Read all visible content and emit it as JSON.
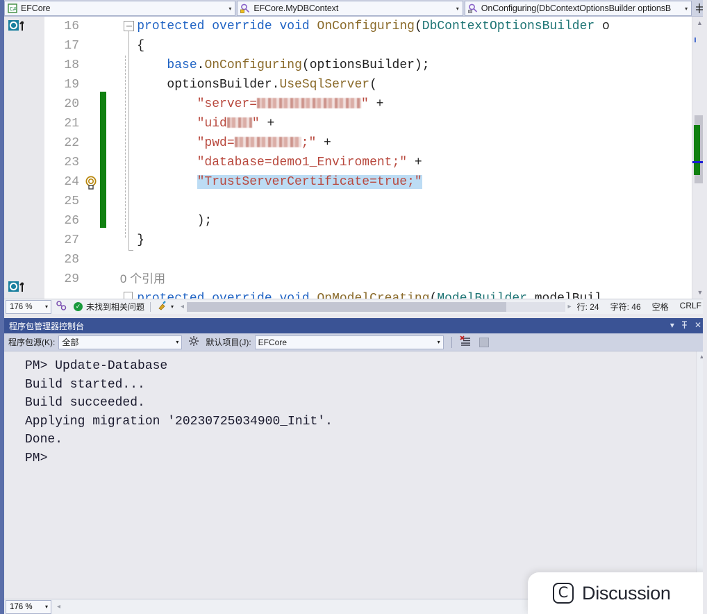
{
  "navbar": {
    "project": {
      "label": "EFCore",
      "icon": "csharp-project-icon"
    },
    "class": {
      "label": "EFCore.MyDBContext",
      "icon": "class-icon"
    },
    "member": {
      "label": "OnConfiguring(DbContextOptionsBuilder optionsB",
      "icon": "method-icon"
    },
    "split_view_icon": "split-view-icon",
    "dropdown_arrow": "▾"
  },
  "editor": {
    "gutter_icon": "inheritance-up-icon",
    "quick_actions_icon": "lightbulb-icon",
    "fold_icon": "collapse-minus-icon",
    "line_numbers": [
      "16",
      "17",
      "18",
      "19",
      "20",
      "21",
      "22",
      "23",
      "24",
      "25",
      "26",
      "27",
      "28",
      "29"
    ],
    "codelens": "0 个引用",
    "lines": [
      {
        "n": "16",
        "tokens": [
          {
            "t": "    ",
            "c": "plain"
          },
          {
            "t": "protected",
            "c": "kw"
          },
          {
            "t": " ",
            "c": "plain"
          },
          {
            "t": "override",
            "c": "kw"
          },
          {
            "t": " ",
            "c": "plain"
          },
          {
            "t": "void",
            "c": "kw"
          },
          {
            "t": " ",
            "c": "plain"
          },
          {
            "t": "OnConfiguring",
            "c": "meth"
          },
          {
            "t": "(",
            "c": "plain"
          },
          {
            "t": "DbContextOptionsBuilder",
            "c": "type"
          },
          {
            "t": " o",
            "c": "plain"
          }
        ]
      },
      {
        "n": "17",
        "tokens": [
          {
            "t": "    {",
            "c": "plain"
          }
        ]
      },
      {
        "n": "18",
        "tokens": [
          {
            "t": "        ",
            "c": "plain"
          },
          {
            "t": "base",
            "c": "kw"
          },
          {
            "t": ".",
            "c": "plain"
          },
          {
            "t": "OnConfiguring",
            "c": "meth"
          },
          {
            "t": "(optionsBuilder);",
            "c": "plain"
          }
        ]
      },
      {
        "n": "19",
        "tokens": [
          {
            "t": "        optionsBuilder.",
            "c": "plain"
          },
          {
            "t": "UseSqlServer",
            "c": "meth"
          },
          {
            "t": "(",
            "c": "plain"
          }
        ]
      },
      {
        "n": "20",
        "tokens": [
          {
            "t": "            ",
            "c": "plain"
          },
          {
            "t": "\"server=",
            "c": "str"
          },
          {
            "t": "REDACT:150",
            "c": "redact"
          },
          {
            "t": "\"",
            "c": "str"
          },
          {
            "t": " +",
            "c": "plain"
          }
        ]
      },
      {
        "n": "21",
        "tokens": [
          {
            "t": "            ",
            "c": "plain"
          },
          {
            "t": "\"uid",
            "c": "str"
          },
          {
            "t": "REDACT:36",
            "c": "redact"
          },
          {
            "t": "\"",
            "c": "str"
          },
          {
            "t": " +",
            "c": "plain"
          }
        ]
      },
      {
        "n": "22",
        "tokens": [
          {
            "t": "            ",
            "c": "plain"
          },
          {
            "t": "\"pwd=",
            "c": "str"
          },
          {
            "t": "REDACT:96",
            "c": "redact"
          },
          {
            "t": ";\"",
            "c": "str"
          },
          {
            "t": " +",
            "c": "plain"
          }
        ]
      },
      {
        "n": "23",
        "tokens": [
          {
            "t": "            ",
            "c": "plain"
          },
          {
            "t": "\"database=demo1_Enviroment;\"",
            "c": "str"
          },
          {
            "t": " +",
            "c": "plain"
          }
        ]
      },
      {
        "n": "24",
        "tokens": [
          {
            "t": "            ",
            "c": "plain"
          },
          {
            "t": "\"TrustServerCertificate=true;\"",
            "c": "str sel"
          }
        ]
      },
      {
        "n": "25",
        "tokens": [
          {
            "t": "",
            "c": "plain"
          }
        ]
      },
      {
        "n": "26",
        "tokens": [
          {
            "t": "            );",
            "c": "plain"
          }
        ]
      },
      {
        "n": "27",
        "tokens": [
          {
            "t": "    }",
            "c": "plain"
          }
        ]
      },
      {
        "n": "28",
        "tokens": [
          {
            "t": "",
            "c": "plain"
          }
        ]
      },
      {
        "n": "29",
        "tokens": [
          {
            "t": "    ",
            "c": "plain"
          },
          {
            "t": "protected override void ",
            "c": "kw"
          },
          {
            "t": "OnModelCreating",
            "c": "meth"
          },
          {
            "t": "(",
            "c": "plain"
          },
          {
            "t": "ModelBuilder",
            "c": "type"
          },
          {
            "t": " modelBuil",
            "c": "plain"
          }
        ]
      }
    ]
  },
  "editor_status": {
    "zoom": "176 %",
    "zoom_arrow": "▾",
    "issues_icon": "check-circle-icon",
    "issues": "未找到相关问题",
    "broom_icon": "code-cleanup-icon",
    "broom_arrow": "▾",
    "line_label": "行: 24",
    "char_label": "字符: 46",
    "indent": "空格",
    "eol": "CRLF",
    "scroll_left_arrow": "◂",
    "scroll_right_arrow": "▸"
  },
  "console": {
    "title": "程序包管理器控制台",
    "window_buttons": {
      "dropdown": "▾",
      "pin": "⚲",
      "close": "✕"
    },
    "source_label": "程序包源(K):",
    "source_value": "全部",
    "settings_icon": "gear-icon",
    "project_label": "默认项目(J):",
    "project_value": "EFCore",
    "clear_icon": "clear-console-icon",
    "stop_icon": "stop-button-icon",
    "arrow": "▾",
    "output": [
      "PM> Update-Database",
      "Build started...",
      "Build succeeded.",
      "Applying migration '20230725034900_Init'.",
      "Done.",
      "PM>"
    ]
  },
  "bottom_status": {
    "zoom": "176 %",
    "zoom_arrow": "▾",
    "scroll_left_arrow": "◂"
  },
  "discussion": {
    "logo": "C",
    "label": "Discussion"
  },
  "colors": {
    "accent_blue": "#3a5395",
    "toolbar": "#ced3e3",
    "keyword": "#1f63c4",
    "type": "#1d7474",
    "method": "#8a6a2a",
    "string": "#b8483d",
    "selection": "#bcdcf4",
    "change_bar": "#108010",
    "success": "#1a9a3c"
  }
}
